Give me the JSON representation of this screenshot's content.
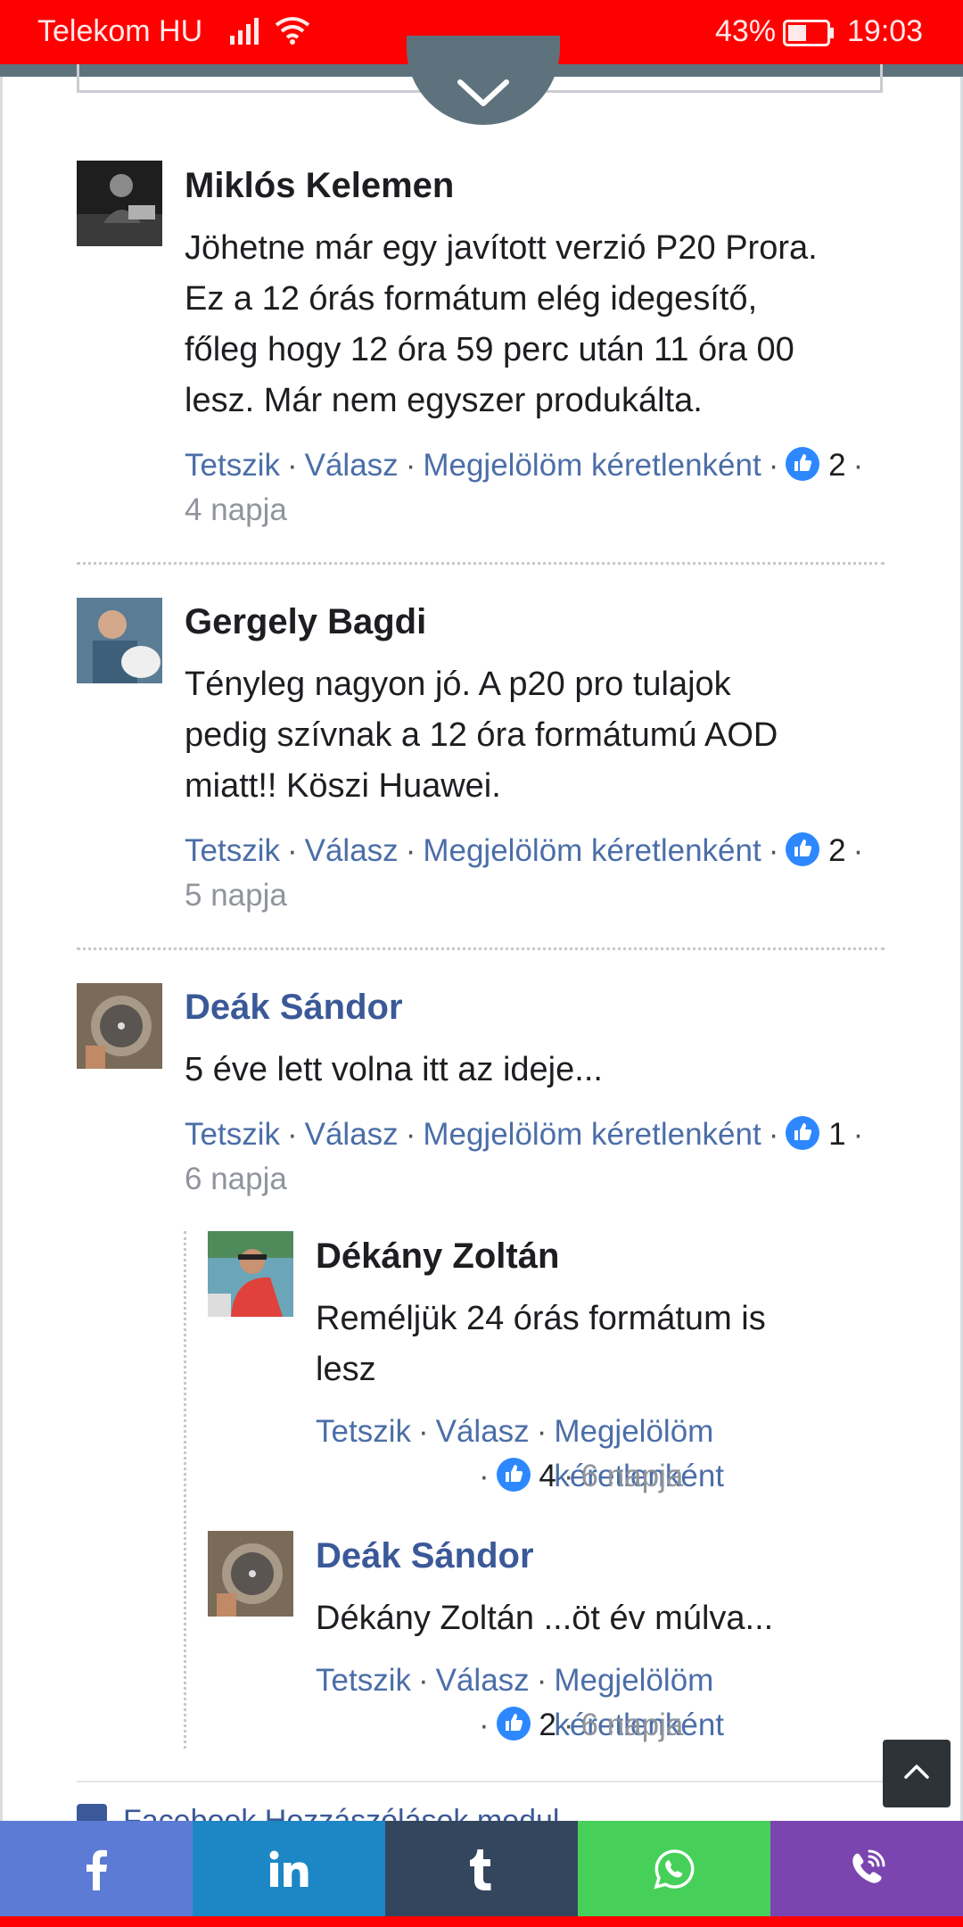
{
  "status_bar": {
    "carrier": "Telekom HU",
    "battery": "43%",
    "time": "19:03"
  },
  "actions": {
    "like": "Tetszik",
    "reply": "Válasz",
    "mark_spam": "Megjelölöm kéretlenként"
  },
  "comments": [
    {
      "author": "Miklós Kelemen",
      "lines": [
        "Jöhetne már egy javított verzió P20 Prora.",
        "Ez a 12 órás formátum elég idegesítő,",
        "főleg hogy 12 óra 59 perc után 11 óra 00",
        "lesz. Már nem egyszer produkálta."
      ],
      "likes": "2",
      "date": "4 napja"
    },
    {
      "author": "Gergely Bagdi",
      "lines": [
        "Tényleg nagyon jó. A p20 pro tulajok",
        "pedig szívnak a 12 óra formátumú AOD",
        "miatt!! Köszi Huawei."
      ],
      "likes": "2",
      "date": "5 napja"
    },
    {
      "author": "Deák Sándor",
      "lines": [
        "5 éve lett volna itt az ideje..."
      ],
      "likes": "1",
      "date": "6 napja"
    }
  ],
  "replies": [
    {
      "author": "Dékány Zoltán",
      "lines": [
        "Reméljük 24 órás formátum is",
        "lesz"
      ],
      "likes": "4",
      "date": "6 napja"
    },
    {
      "author": "Deák Sándor",
      "lines": [
        "Dékány Zoltán ...öt év múlva..."
      ],
      "likes": "2",
      "date": "6 napja"
    }
  ],
  "footer": {
    "fb_module": "Facebook Hozzászólások modul"
  },
  "share_bar": [
    "facebook-icon",
    "linkedin-icon",
    "tumblr-icon",
    "whatsapp-icon",
    "viber-icon"
  ],
  "colors": {
    "status_bar": "#ff0000",
    "link": "#4b6ea8",
    "author_link": "#3b5998",
    "like_badge": "#2d88ff"
  }
}
